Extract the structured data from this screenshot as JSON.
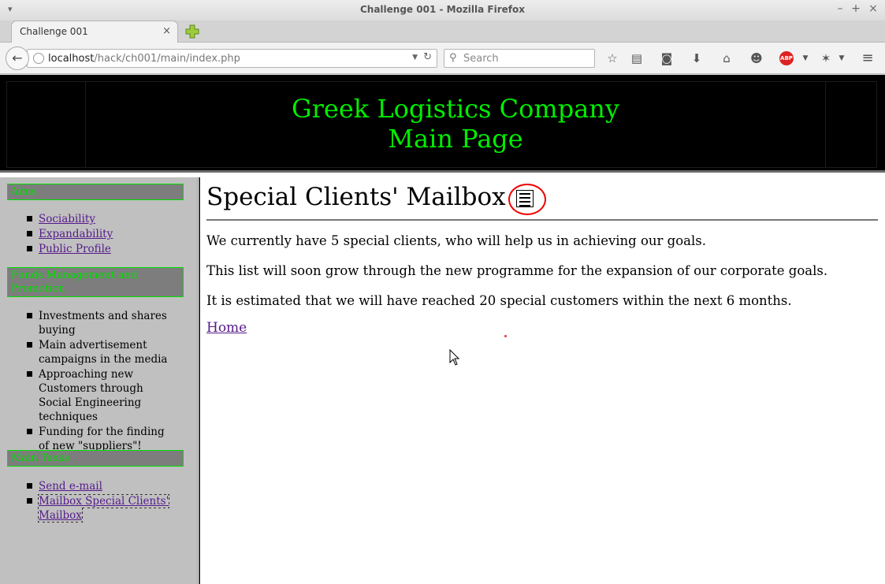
{
  "window": {
    "title": "Challenge 001 - Mozilla Firefox",
    "controls": [
      "–",
      "+",
      "×"
    ]
  },
  "tab": {
    "label": "Challenge 001",
    "close": "×"
  },
  "navbar": {
    "url_host": "localhost",
    "url_path": "/hack/ch001/main/index.php",
    "search_placeholder": "Search",
    "abp_label": "ABP"
  },
  "page": {
    "header_line1": "Greek Logistics Company",
    "header_line2": "Main Page",
    "sidebar": {
      "aims": {
        "title": "Aims",
        "items": [
          "Sociability",
          "Expandability",
          "Public Profile"
        ]
      },
      "funds": {
        "title": "Funds Management and Promotion",
        "items": [
          "Investments and shares buying",
          "Main advertisement campaigns in the media",
          "Approaching new Customers through Social Engineering techniques",
          "Funding for the finding of new \"suppliers\"!"
        ]
      },
      "tasks": {
        "title": "Main Tasks",
        "items": [
          "Send e-mail",
          "Mailbox Special Clients' Mailbox"
        ]
      }
    },
    "main": {
      "heading": "Special Clients' Mailbox",
      "paragraphs": [
        "We currently have 5 special clients, who will help us in achieving our goals.",
        "This list will soon grow through the new programme for the expansion of our corporate goals.",
        "It is estimated that we will have reached 20 special customers within the next 6 months."
      ],
      "home_link": "Home"
    }
  },
  "colors": {
    "header_text": "#00ee00",
    "link": "#551a8b",
    "sidebar_bg": "#c0c0c0",
    "annotation": "#ee0000"
  }
}
